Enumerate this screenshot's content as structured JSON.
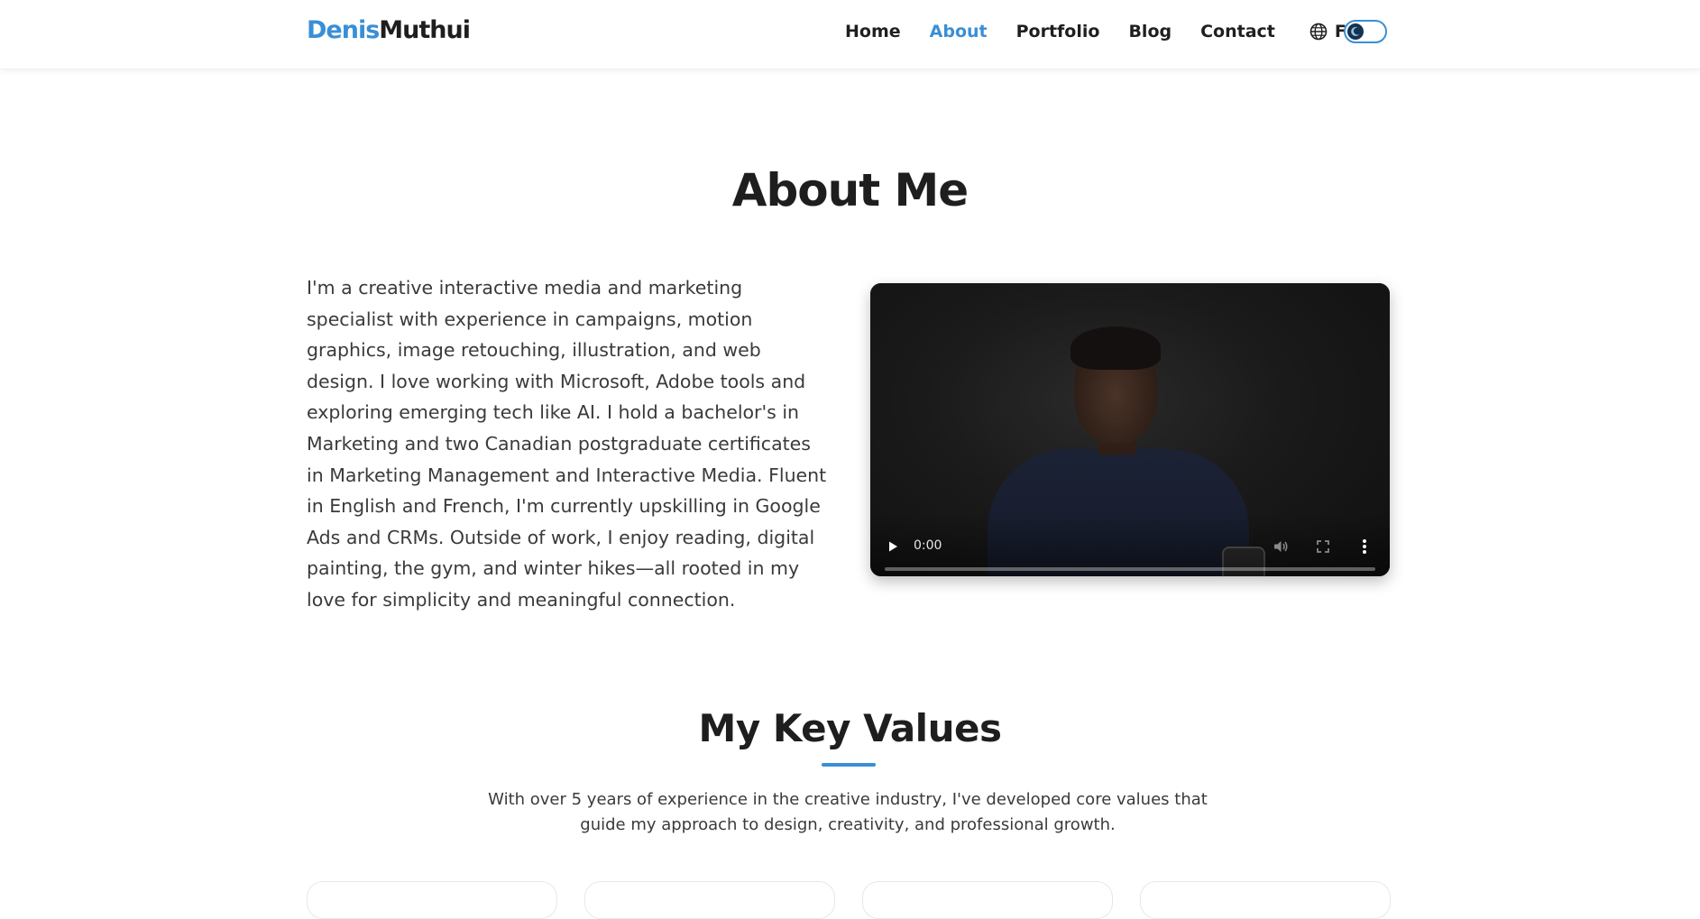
{
  "header": {
    "logo_first": "Denis",
    "logo_last": "Muthui",
    "nav": [
      "Home",
      "About",
      "Portfolio",
      "Blog",
      "Contact"
    ],
    "active": "About",
    "language_label": "FR",
    "language_icon": "globe-icon",
    "theme_toggle_icon": "moon-icon"
  },
  "about": {
    "title": "About Me",
    "body": "I'm a creative interactive media and marketing specialist with experience in campaigns, motion graphics, image retouching, illustration, and web design. I love working with Microsoft, Adobe tools and exploring emerging tech like AI. I hold a bachelor's in Marketing and two Canadian postgraduate certificates in Marketing Management and Interactive Media. Fluent in English and French, I'm currently upskilling in Google Ads and CRMs. Outside of work, I enjoy reading, digital painting, the gym, and winter hikes—all rooted in my love for simplicity and meaningful connection."
  },
  "video": {
    "time": "0:00",
    "progress": 0
  },
  "values": {
    "title": "My Key Values",
    "intro": "With over 5 years of experience in the creative industry, I've developed core values that guide my approach to design, creativity, and professional growth."
  },
  "colors": {
    "accent": "#3a8fd6",
    "text_dark": "#1e1e1e",
    "text_body": "#3a3a3a"
  }
}
